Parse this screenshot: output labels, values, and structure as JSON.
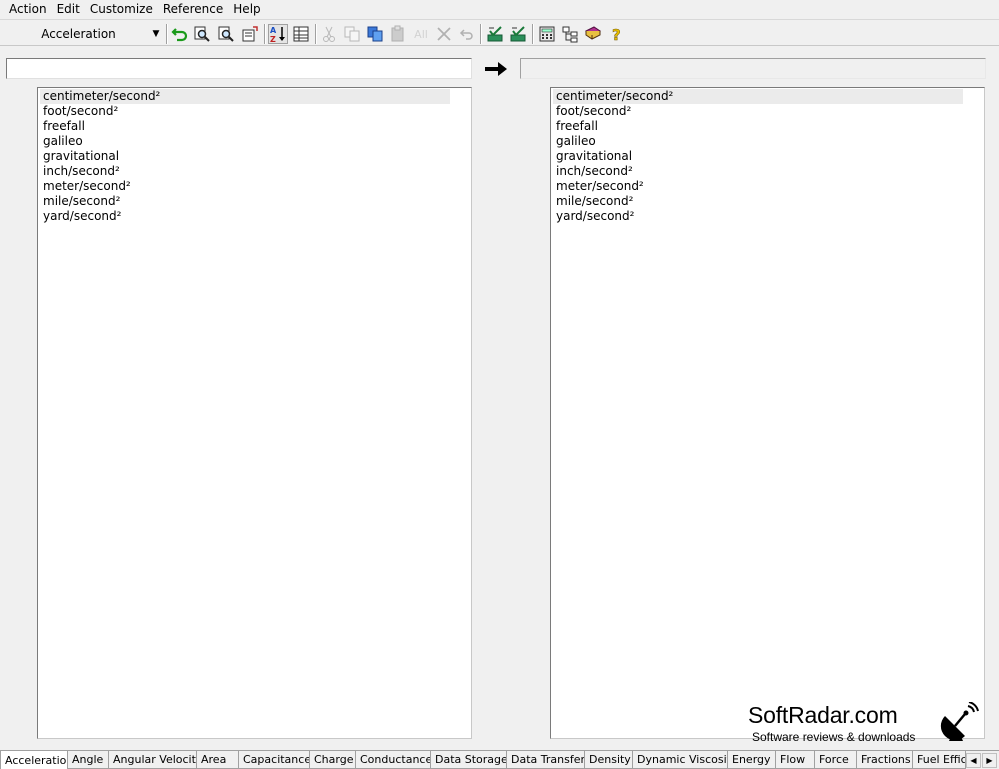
{
  "menubar": {
    "items": [
      "Action",
      "Edit",
      "Customize",
      "Reference",
      "Help"
    ]
  },
  "toolbar": {
    "category_value": "Acceleration",
    "all_label": "All",
    "icons": [
      "undo-icon",
      "find-icon",
      "find-next-icon",
      "properties-icon",
      "sort-az-icon",
      "details-view-icon",
      "cut-icon",
      "copy-icon",
      "paste-special-icon",
      "paste-icon",
      "select-all-icon",
      "delete-icon",
      "undo-disabled-icon",
      "checklist-icon",
      "checklist-alt-icon",
      "calculator-icon",
      "tree-icon",
      "book-icon",
      "help-icon"
    ]
  },
  "converter": {
    "from_value": "",
    "to_value": "",
    "arrow_icon": "right-arrow-icon"
  },
  "left_list": {
    "selected_index": 0,
    "items": [
      "centimeter/second²",
      "foot/second²",
      "freefall",
      "galileo",
      "gravitational",
      "inch/second²",
      "meter/second²",
      "mile/second²",
      "yard/second²"
    ]
  },
  "right_list": {
    "selected_index": 0,
    "items": [
      "centimeter/second²",
      "foot/second²",
      "freefall",
      "galileo",
      "gravitational",
      "inch/second²",
      "meter/second²",
      "mile/second²",
      "yard/second²"
    ]
  },
  "watermark": {
    "title": "SoftRadar.com",
    "subtitle": "Software reviews & downloads"
  },
  "tabs": {
    "active_index": 0,
    "items": [
      "Acceleration",
      "Angle",
      "Angular Velocity",
      "Area",
      "Capacitance",
      "Charge",
      "Conductance",
      "Data Storage",
      "Data Transfer",
      "Density",
      "Dynamic Viscosity",
      "Energy",
      "Flow",
      "Force",
      "Fractions",
      "Fuel Effic"
    ]
  }
}
